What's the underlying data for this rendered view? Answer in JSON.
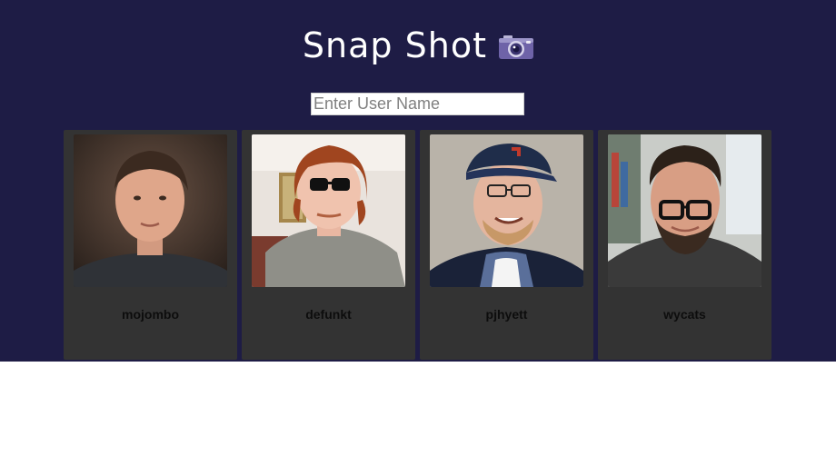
{
  "app": {
    "title": "Snap Shot"
  },
  "search": {
    "placeholder": "Enter User Name",
    "value": ""
  },
  "users": [
    {
      "login": "mojombo"
    },
    {
      "login": "defunkt"
    },
    {
      "login": "pjhyett"
    },
    {
      "login": "wycats"
    }
  ]
}
